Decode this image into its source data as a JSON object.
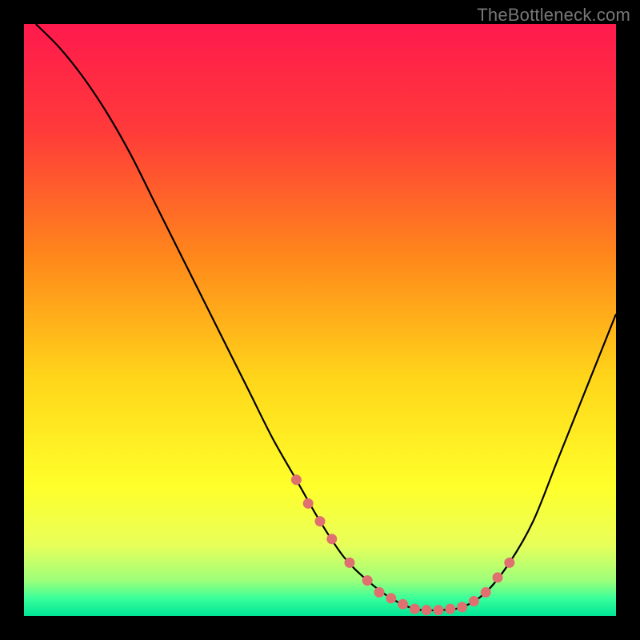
{
  "watermark": "TheBottleneck.com",
  "chart_data": {
    "type": "line",
    "title": "",
    "xlabel": "",
    "ylabel": "",
    "xlim": [
      0,
      100
    ],
    "ylim": [
      0,
      100
    ],
    "grid": false,
    "legend": false,
    "series": [
      {
        "name": "curve",
        "x": [
          2,
          6,
          10,
          14,
          18,
          22,
          26,
          30,
          34,
          38,
          42,
          46,
          50,
          54,
          58,
          62,
          66,
          70,
          74,
          78,
          82,
          86,
          90,
          94,
          98,
          100
        ],
        "y": [
          100,
          96,
          91,
          85,
          78,
          70,
          62,
          54,
          46,
          38,
          30,
          23,
          16,
          10,
          6,
          3,
          1.2,
          1,
          1.5,
          4,
          9,
          16,
          26,
          36,
          46,
          51
        ]
      }
    ],
    "markers": {
      "name": "highlight-dots",
      "x": [
        46,
        48,
        50,
        52,
        55,
        58,
        60,
        62,
        64,
        66,
        68,
        70,
        72,
        74,
        76,
        78,
        80,
        82
      ],
      "y": [
        23,
        19,
        16,
        13,
        9,
        6,
        4,
        3,
        2,
        1.2,
        1,
        1,
        1.2,
        1.5,
        2.5,
        4,
        6.5,
        9
      ]
    },
    "gradient_stops": [
      {
        "offset": 0.0,
        "color": "#ff1a4d"
      },
      {
        "offset": 0.18,
        "color": "#ff3a3a"
      },
      {
        "offset": 0.4,
        "color": "#ff8a1a"
      },
      {
        "offset": 0.6,
        "color": "#ffd61a"
      },
      {
        "offset": 0.78,
        "color": "#ffff2a"
      },
      {
        "offset": 0.88,
        "color": "#e8ff5a"
      },
      {
        "offset": 0.94,
        "color": "#9dff7a"
      },
      {
        "offset": 0.97,
        "color": "#3aff9a"
      },
      {
        "offset": 1.0,
        "color": "#00e596"
      }
    ],
    "dot_color": "#e07070",
    "curve_color": "#000000"
  }
}
